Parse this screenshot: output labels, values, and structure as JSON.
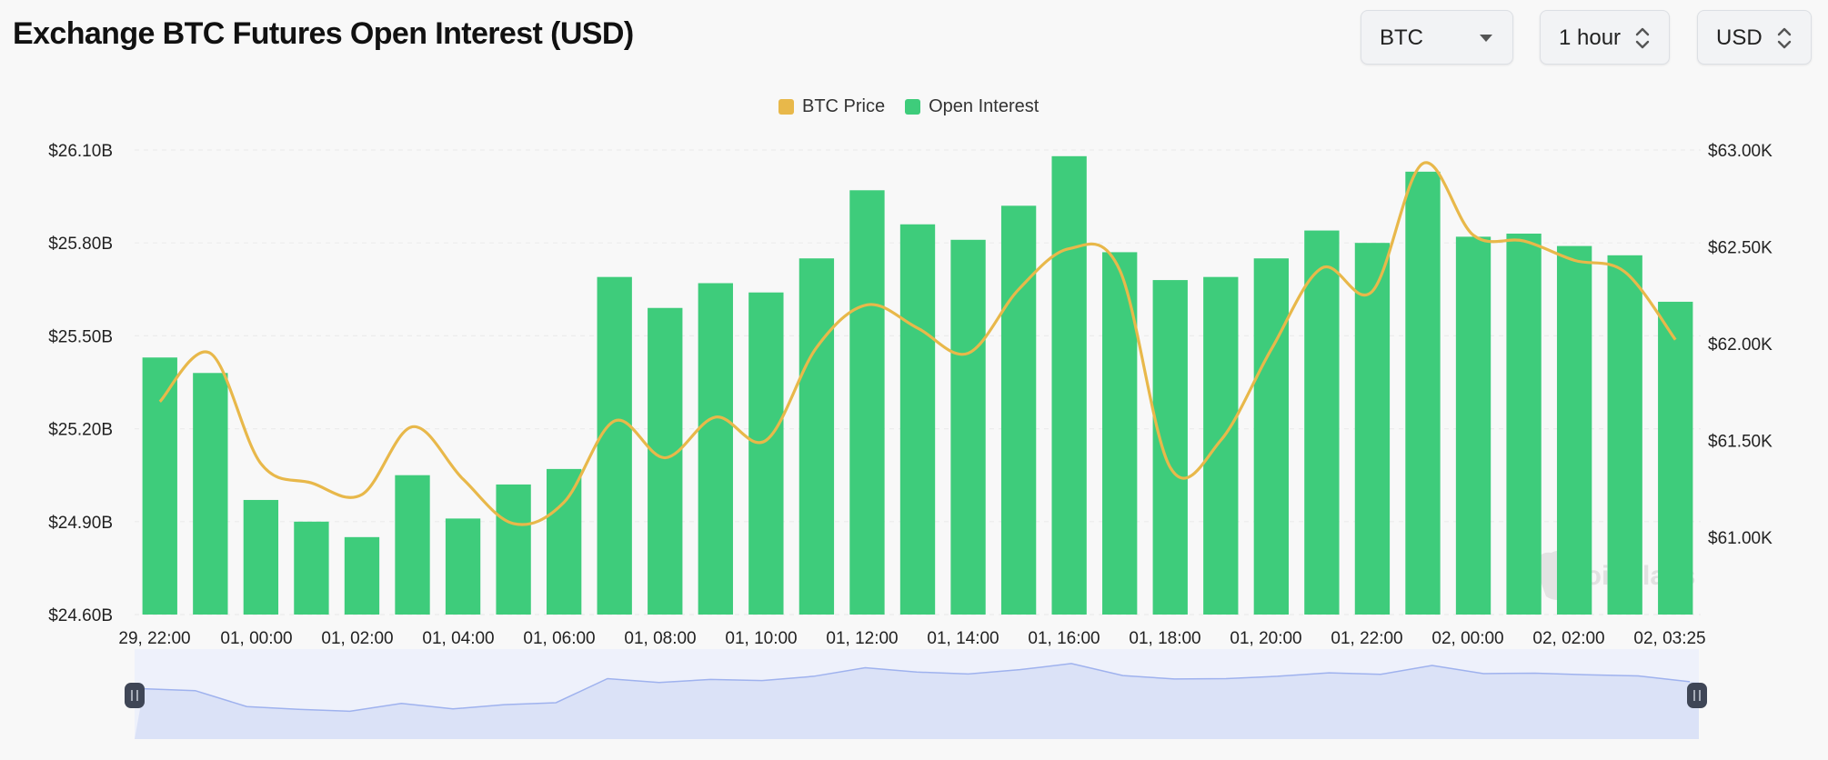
{
  "title": "Exchange BTC Futures Open Interest (USD)",
  "controls": {
    "coin": "BTC",
    "interval": "1 hour",
    "currency": "USD"
  },
  "colors": {
    "open_interest": "#3ecc7b",
    "btc_price": "#e8b84a",
    "grid": "#ececec",
    "navigator_fill": "#dbe2f7",
    "navigator_line": "#9fb2ee",
    "handle": "#3f4656"
  },
  "watermark": "coinglass",
  "chart_data": {
    "type": "bar",
    "legend": [
      "BTC Price",
      "Open Interest"
    ],
    "legend_position": "top-center",
    "grid": true,
    "x_tick_labels": [
      "29, 22:00",
      "01, 00:00",
      "01, 02:00",
      "01, 04:00",
      "01, 06:00",
      "01, 08:00",
      "01, 10:00",
      "01, 12:00",
      "01, 14:00",
      "01, 16:00",
      "01, 18:00",
      "01, 20:00",
      "01, 22:00",
      "02, 00:00",
      "02, 02:00",
      "02, 03:25"
    ],
    "y_left": {
      "ticks": [
        "$24.60B",
        "$24.90B",
        "$25.20B",
        "$25.50B",
        "$25.80B",
        "$26.10B"
      ],
      "range": [
        24.6,
        26.1
      ]
    },
    "y_right": {
      "ticks": [
        "$61.00K",
        "$61.50K",
        "$62.00K",
        "$62.50K",
        "$63.00K"
      ],
      "range": [
        60.6,
        63.0
      ]
    },
    "series": [
      {
        "name": "Open Interest",
        "type": "bar",
        "axis": "left",
        "unit": "B USD",
        "values": [
          25.43,
          25.38,
          24.97,
          24.9,
          24.85,
          25.05,
          24.91,
          25.02,
          25.07,
          25.69,
          25.59,
          25.67,
          25.64,
          25.75,
          25.97,
          25.86,
          25.81,
          25.92,
          26.08,
          25.77,
          25.68,
          25.69,
          25.75,
          25.84,
          25.8,
          26.03,
          25.82,
          25.83,
          25.79,
          25.76,
          25.61
        ]
      },
      {
        "name": "BTC Price",
        "type": "line",
        "axis": "right",
        "unit": "K USD",
        "values": [
          61.7,
          61.95,
          61.38,
          61.28,
          61.22,
          61.57,
          61.3,
          61.07,
          61.18,
          61.6,
          61.41,
          61.62,
          61.5,
          61.98,
          62.2,
          62.08,
          61.95,
          62.28,
          62.49,
          62.38,
          61.36,
          61.5,
          61.97,
          62.39,
          62.27,
          62.93,
          62.56,
          62.53,
          62.43,
          62.37,
          62.02
        ]
      }
    ]
  }
}
